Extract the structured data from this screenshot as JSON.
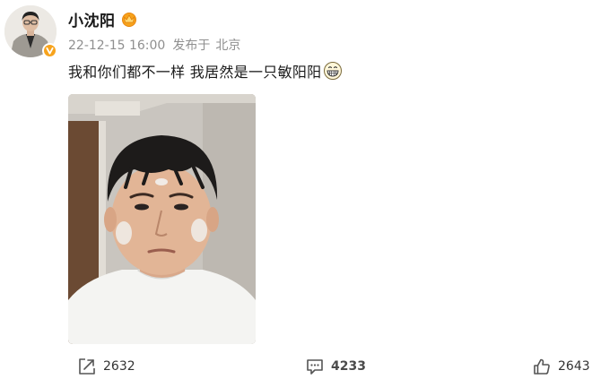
{
  "user": {
    "name": "小沈阳",
    "avatar_icon": "user-avatar",
    "verified_icon": "verified-v-badge-icon",
    "badge_icon": "crown-member-icon",
    "badge_color": "#f7a31c"
  },
  "post": {
    "timestamp": "22-12-15 16:00",
    "posted_from_label": "发布于",
    "location": "北京",
    "text": "我和你们都不一样 我居然是一只敏阳阳",
    "emoji_icon": "grinning-face-icon",
    "photo_description": "selfie-photo"
  },
  "actions": {
    "share_count": "2632",
    "comment_count": "4233",
    "like_count": "2643",
    "share_icon": "share-forward-icon",
    "comment_icon": "comment-bubble-icon",
    "like_icon": "thumbs-up-icon"
  },
  "colors": {
    "text": "#1a1a1a",
    "meta": "#8f8f8f",
    "icon": "#555555",
    "badge": "#f7a31c"
  }
}
